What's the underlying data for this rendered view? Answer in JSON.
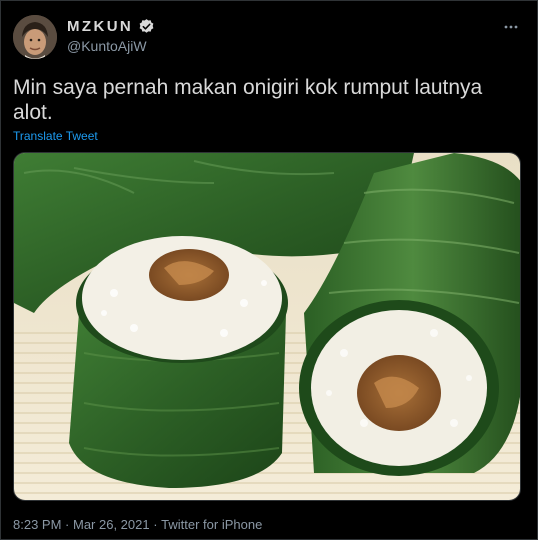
{
  "user": {
    "display_name": "MZKUN",
    "handle": "@KuntoAjiW",
    "verified": true
  },
  "tweet": {
    "text": "Min saya pernah makan onigiri kok rumput lautnya alot.",
    "translate_label": "Translate Tweet",
    "media_description": "",
    "time": "8:23 PM",
    "date": "Mar 26, 2021",
    "separator": " · ",
    "source": "Twitter for iPhone"
  },
  "icons": {
    "more": "more-icon",
    "verified": "verified-badge-icon"
  },
  "colors": {
    "background": "#000000",
    "text": "#d9d9d9",
    "secondary": "#8b98a5",
    "link": "#1d9bf0",
    "leaf": "#2f6b2a",
    "rice": "#f2efe4"
  }
}
